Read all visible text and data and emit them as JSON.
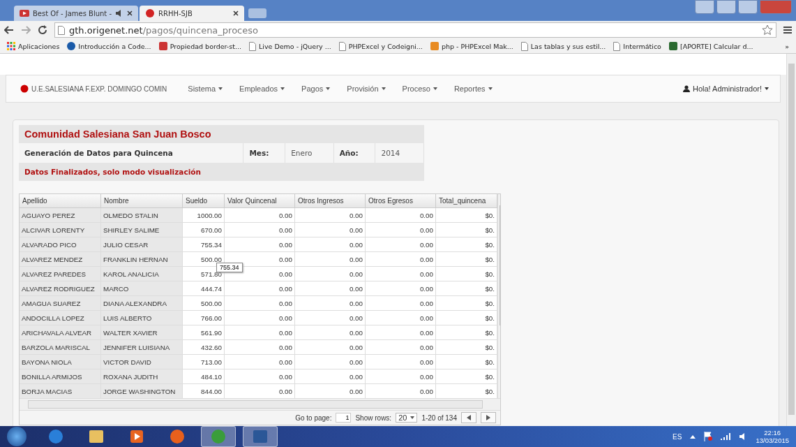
{
  "browser": {
    "tabs": [
      {
        "title": "Best Of - James Blunt -",
        "selected": false,
        "audio": true
      },
      {
        "title": "RRHH-SJB",
        "selected": true,
        "audio": false
      }
    ],
    "address": {
      "host": "gth.origenet.net",
      "path": "/pagos/quincena_proceso"
    },
    "bookmarks": [
      {
        "label": "Aplicaciones",
        "kind": "apps"
      },
      {
        "label": "Introducción a Code...",
        "kind": "globe"
      },
      {
        "label": "Propiedad border-st...",
        "kind": "book"
      },
      {
        "label": "Live Demo - jQuery ...",
        "kind": "page"
      },
      {
        "label": "PHPExcel y Codeigni...",
        "kind": "page"
      },
      {
        "label": "php - PHPExcel Mak...",
        "kind": "stack"
      },
      {
        "label": "Las tablas y sus estil...",
        "kind": "page"
      },
      {
        "label": "Intermático",
        "kind": "page"
      },
      {
        "label": "[APORTE] Calcular d...",
        "kind": "badge"
      }
    ],
    "more": "»"
  },
  "navbar": {
    "brand": "U.E.SALESIANA F.EXP. DOMINGO COMIN",
    "menus": [
      "Sistema",
      "Empleados",
      "Pagos",
      "Provisión",
      "Proceso",
      "Reportes"
    ],
    "user": "Hola! Administrador!"
  },
  "info": {
    "title": "Comunidad Salesiana San Juan Bosco",
    "subtitle": "Generación de Datos para Quincena",
    "month_label": "Mes:",
    "month": "Enero",
    "year_label": "Año:",
    "year": "2014",
    "status": "Datos Finalizados, solo modo visualización"
  },
  "table": {
    "columns": [
      "Apellido",
      "Nombre",
      "Sueldo",
      "Valor Quincenal",
      "Otros Ingresos",
      "Otros Egresos",
      "Total_quincena"
    ],
    "rows": [
      [
        "AGUAYO PEREZ",
        "OLMEDO STALIN",
        "1000.00",
        "0.00",
        "0.00",
        "0.00",
        "$0."
      ],
      [
        "ALCIVAR LORENTY",
        "SHIRLEY SALIME",
        "670.00",
        "0.00",
        "0.00",
        "0.00",
        "$0."
      ],
      [
        "ALVARADO PICO",
        "JULIO CESAR",
        "755.34",
        "0.00",
        "0.00",
        "0.00",
        "$0."
      ],
      [
        "ALVAREZ MENDEZ",
        "FRANKLIN HERNAN",
        "500.00",
        "0.00",
        "0.00",
        "0.00",
        "$0."
      ],
      [
        "ALVAREZ PAREDES",
        "KAROL ANALICIA",
        "571.80",
        "0.00",
        "0.00",
        "0.00",
        "$0."
      ],
      [
        "ALVAREZ RODRIGUEZ",
        "MARCO",
        "444.74",
        "0.00",
        "0.00",
        "0.00",
        "$0."
      ],
      [
        "AMAGUA SUAREZ",
        "DIANA ALEXANDRA",
        "500.00",
        "0.00",
        "0.00",
        "0.00",
        "$0."
      ],
      [
        "ANDOCILLA LOPEZ",
        "LUIS ALBERTO",
        "766.00",
        "0.00",
        "0.00",
        "0.00",
        "$0."
      ],
      [
        "ARICHAVALA ALVEAR",
        "WALTER XAVIER",
        "561.90",
        "0.00",
        "0.00",
        "0.00",
        "$0."
      ],
      [
        "BARZOLA MARISCAL",
        "JENNIFER LUISIANA",
        "432.60",
        "0.00",
        "0.00",
        "0.00",
        "$0."
      ],
      [
        "BAYONA NIOLA",
        "VICTOR DAVID",
        "713.00",
        "0.00",
        "0.00",
        "0.00",
        "$0."
      ],
      [
        "BONILLA ARMIJOS",
        "ROXANA JUDITH",
        "484.10",
        "0.00",
        "0.00",
        "0.00",
        "$0."
      ],
      [
        "BORJA MACIAS",
        "JORGE WASHINGTON",
        "844.00",
        "0.00",
        "0.00",
        "0.00",
        "$0."
      ]
    ],
    "tooltip": "755.34"
  },
  "pager": {
    "goto_label": "Go to page:",
    "page": "1",
    "rows_label": "Show rows:",
    "rows": "20",
    "range": "1-20 of 134"
  },
  "taskbar": {
    "apps": [
      {
        "kind": "ie",
        "active": false
      },
      {
        "kind": "folder",
        "active": false
      },
      {
        "kind": "media",
        "active": false
      },
      {
        "kind": "firefox",
        "active": false
      },
      {
        "kind": "chrome",
        "active": true
      },
      {
        "kind": "word",
        "active": true
      }
    ],
    "lang": "ES",
    "time": "22:16",
    "date": "13/03/2015"
  }
}
